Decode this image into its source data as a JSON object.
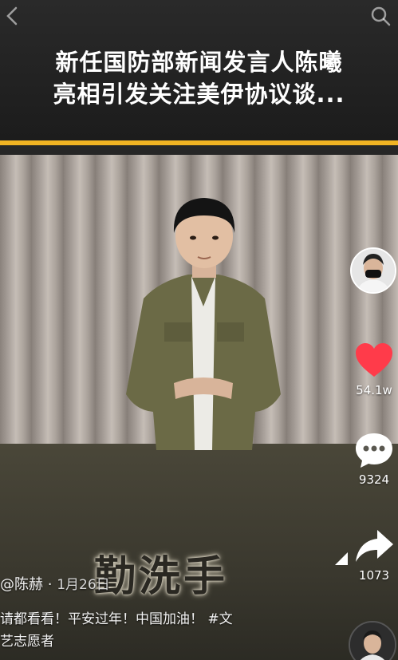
{
  "header": {
    "headline_line1": "新任国防部新闻发言人陈曦",
    "headline_line2": "亮相引发关注美伊协议谈...",
    "back_icon": "chevron-left-icon",
    "search_icon": "search-icon"
  },
  "colors": {
    "accent": "#f0b323",
    "like": "#ff3b4a",
    "text": "#ffffff"
  },
  "video": {
    "overlay_caption": "勤洗手",
    "author": "@陈赫",
    "date": "1月26日",
    "description_line1": "请都看看！平安过年！中国加油！ #文",
    "description_line2": "艺志愿者"
  },
  "side_actions": {
    "like_count": "54.1w",
    "comment_count": "9324",
    "share_count": "1073"
  }
}
